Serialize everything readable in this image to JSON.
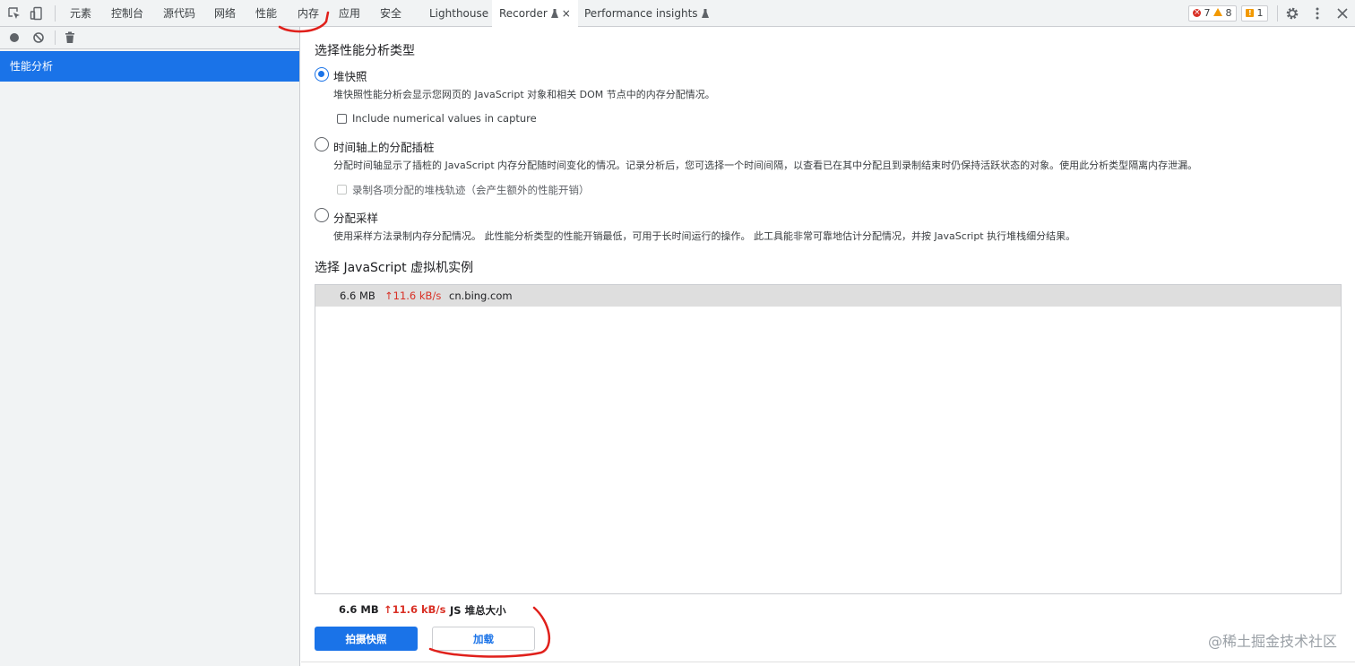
{
  "toolbar": {
    "icons": [
      "inspect-element-icon",
      "device-toolbar-icon"
    ],
    "tabs": [
      {
        "label": "元素"
      },
      {
        "label": "控制台"
      },
      {
        "label": "源代码"
      },
      {
        "label": "网络"
      },
      {
        "label": "性能"
      },
      {
        "label": "内存"
      },
      {
        "label": "应用"
      },
      {
        "label": "安全"
      },
      {
        "label": "Lighthouse"
      },
      {
        "label": "Recorder"
      },
      {
        "label": "Performance insights"
      }
    ],
    "active_tab": "Recorder",
    "close_glyph": "×",
    "errors": "7",
    "warnings": "8",
    "issues": "1"
  },
  "sidebar": {
    "tools": [
      "record-icon",
      "clear-icon",
      "delete-icon"
    ],
    "selected_item": "性能分析"
  },
  "main": {
    "profile_type_title": "选择性能分析类型",
    "options": [
      {
        "label": "堆快照",
        "desc": "堆快照性能分析会显示您网页的 JavaScript 对象和相关 DOM 节点中的内存分配情况。",
        "checked": true,
        "checkbox_label": "Include numerical values in capture",
        "checkbox_disabled": false
      },
      {
        "label": "时间轴上的分配插桩",
        "desc": "分配时间轴显示了插桩的 JavaScript 内存分配随时间变化的情况。记录分析后，您可选择一个时间间隔，以查看已在其中分配且到录制结束时仍保持活跃状态的对象。使用此分析类型隔离内存泄漏。",
        "checked": false,
        "checkbox_label": "录制各项分配的堆栈轨迹（会产生额外的性能开销）",
        "checkbox_disabled": true
      },
      {
        "label": "分配采样",
        "desc": "使用采样方法录制内存分配情况。 此性能分析类型的性能开销最低，可用于长时间运行的操作。 此工具能非常可靠地估计分配情况，并按 JavaScript 执行堆栈细分结果。",
        "checked": false
      }
    ],
    "vm_title": "选择 JavaScript 虚拟机实例",
    "vm_instances": [
      {
        "size": "6.6 MB",
        "rate": "↑11.6 kB/s",
        "host": "cn.bing.com"
      }
    ],
    "summary": {
      "size": "6.6 MB",
      "rate": "↑11.6 kB/s",
      "label": "JS 堆总大小"
    },
    "primary_button": "拍摄快照",
    "secondary_button": "加载"
  },
  "watermark": "@稀土掘金技术社区",
  "colors": {
    "accent": "#1a73e8",
    "error": "#d93025",
    "warning": "#f29900",
    "annotation": "#e0201b"
  }
}
